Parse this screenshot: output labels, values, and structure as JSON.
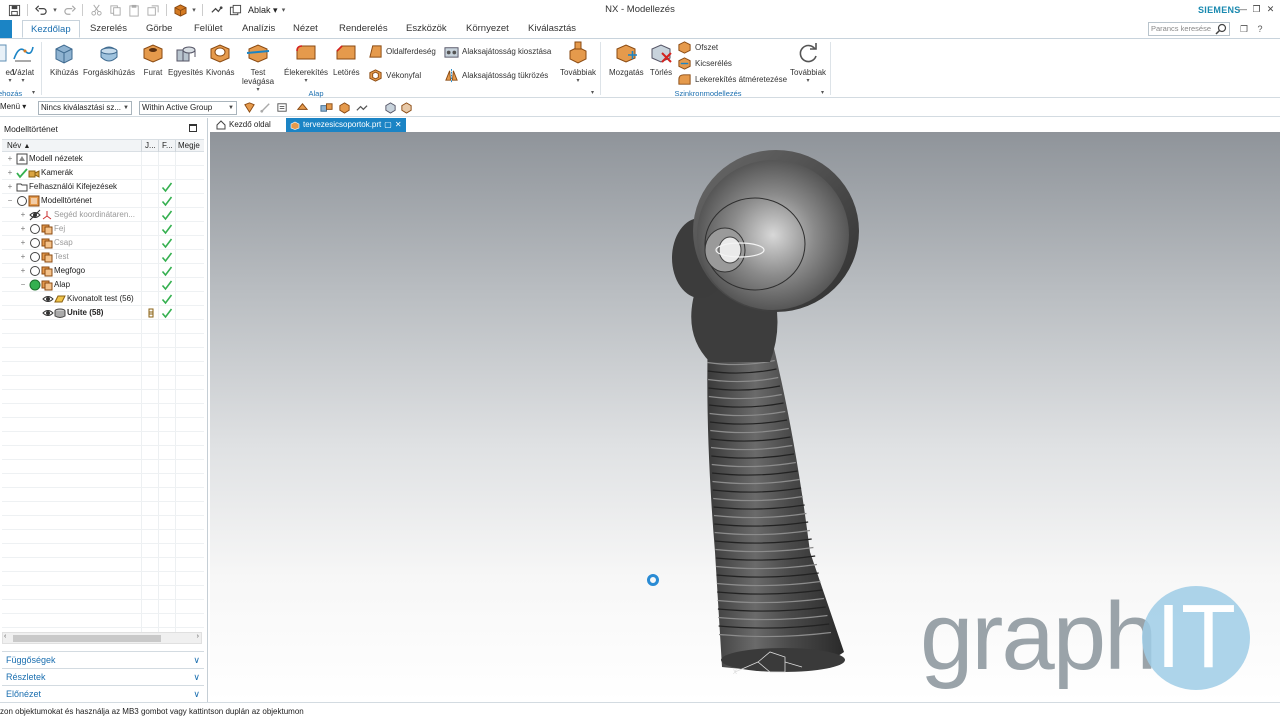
{
  "app": {
    "title": "NX - Modellezés",
    "brand": "SIEMENS",
    "accent_color": "#1b84c5"
  },
  "qat": {
    "window_menu": "Ablak"
  },
  "ribbon_tabs": [
    {
      "label": "Kezdőlap",
      "active": true
    },
    {
      "label": "Szerelés"
    },
    {
      "label": "Görbe"
    },
    {
      "label": "Felület"
    },
    {
      "label": "Analízis"
    },
    {
      "label": "Nézet"
    },
    {
      "label": "Renderelés"
    },
    {
      "label": "Eszközök"
    },
    {
      "label": "Környezet"
    },
    {
      "label": "Kiválasztás"
    }
  ],
  "command_search": {
    "placeholder": "Parancs keresése"
  },
  "ribbon": {
    "left_items": [
      {
        "label": "ed"
      },
      {
        "label": "Vázlat"
      }
    ],
    "left_group_label": "ehozás",
    "alap_items": [
      {
        "label": "Kihúzás"
      },
      {
        "label": "Forgáskihúzás"
      },
      {
        "label": "Furat"
      },
      {
        "label": "Egyesítés"
      },
      {
        "label": "Kivonás"
      },
      {
        "label": "Test levágása",
        "line1": "Test",
        "line2": "levágása"
      },
      {
        "label": "Élekerekítés"
      },
      {
        "label": "Letörés"
      }
    ],
    "alap_small": [
      {
        "label": "Oldalferdeség"
      },
      {
        "label": "Vékonyfal"
      },
      {
        "label": "Alaksajátosság kiosztása"
      },
      {
        "label": "Alaksajátosság tükrözés"
      }
    ],
    "alap_more": "Továbbiak",
    "alap_group_label": "Alap",
    "sync_items": [
      {
        "label": "Mozgatás"
      },
      {
        "label": "Törlés"
      }
    ],
    "sync_small": [
      {
        "label": "Ofszet"
      },
      {
        "label": "Kicserélés"
      },
      {
        "label": "Lekerekítés átméretezése"
      }
    ],
    "sync_more": "Továbbiak",
    "sync_group_label": "Szinkronmodellezés"
  },
  "selection_bar": {
    "menu": "Menü",
    "filter": "Nincs kiválasztási sz...",
    "scope": "Within Active Group"
  },
  "navigator": {
    "title": "Modelltörténet",
    "columns": [
      "Név",
      "J...",
      "F...",
      "Megje"
    ],
    "rows": [
      {
        "label": "Modell nézetek",
        "level": 0,
        "icon": "model-views",
        "check": false,
        "style": ""
      },
      {
        "label": "Kamerák",
        "level": 0,
        "icon": "camera",
        "check": false,
        "style": ""
      },
      {
        "label": "Felhasználói Kifejezések",
        "level": 0,
        "icon": "folder",
        "check": true,
        "style": ""
      },
      {
        "label": "Modelltörténet",
        "level": 0,
        "icon": "history",
        "check": true,
        "style": ""
      },
      {
        "label": "Segéd koordinátaren...",
        "level": 1,
        "icon": "csys",
        "check": true,
        "style": "dim"
      },
      {
        "label": "Fej",
        "level": 1,
        "icon": "group",
        "check": true,
        "style": "dim"
      },
      {
        "label": "Csap",
        "level": 1,
        "icon": "group",
        "check": true,
        "style": "dim"
      },
      {
        "label": "Test",
        "level": 1,
        "icon": "group",
        "check": true,
        "style": "dim"
      },
      {
        "label": "Megfogo",
        "level": 1,
        "icon": "group",
        "check": true,
        "style": ""
      },
      {
        "label": "Alap",
        "level": 1,
        "icon": "group-active",
        "check": true,
        "style": ""
      },
      {
        "label": "Kivonatolt test (56)",
        "level": 2,
        "icon": "extract-body",
        "check": true,
        "style": ""
      },
      {
        "label": "Unite (58)",
        "level": 2,
        "icon": "unite",
        "check": true,
        "style": "bold"
      }
    ]
  },
  "panels": [
    {
      "label": "Függőségek"
    },
    {
      "label": "Részletek"
    },
    {
      "label": "Előnézet"
    }
  ],
  "doc_tabs": [
    {
      "label": "Kezdő oldal",
      "active": false
    },
    {
      "label": "tervezesicsoportok.prt",
      "active": true
    }
  ],
  "logo": {
    "text": "graph",
    "badge": "IT"
  },
  "status": {
    "message": "zon objektumokat és használja az MB3 gombot vagy kattintson duplán az objektumon"
  }
}
